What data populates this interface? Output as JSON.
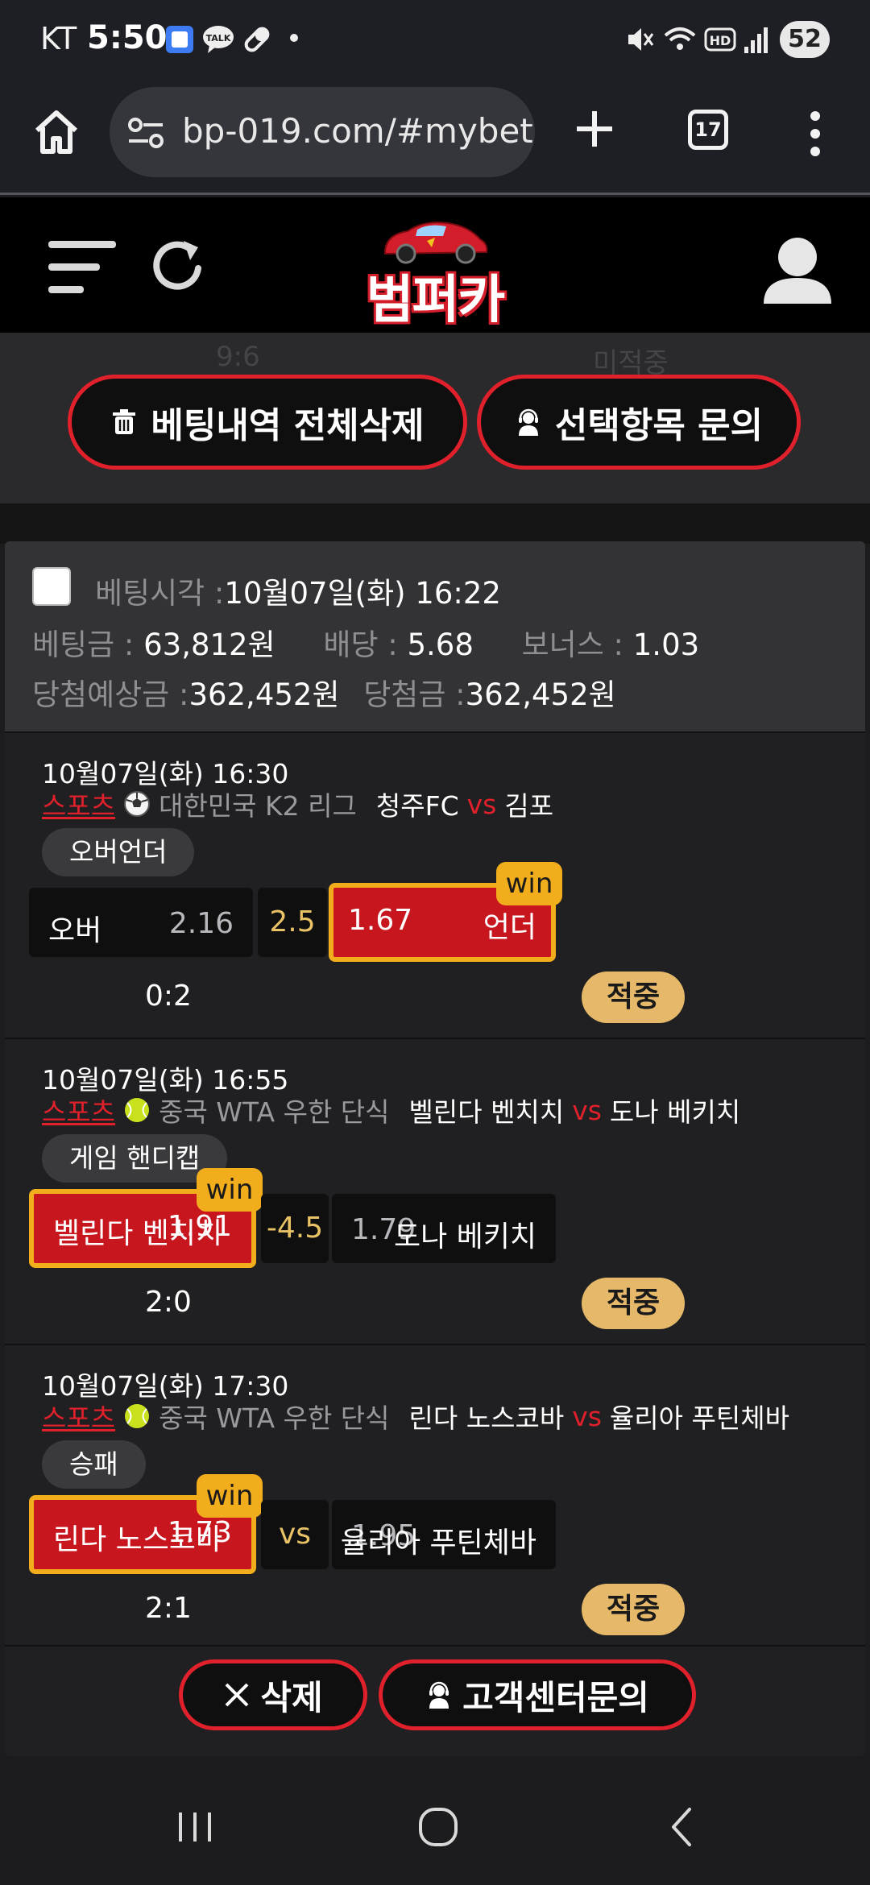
{
  "status_bar": {
    "carrier": "KT",
    "time": "5:50",
    "battery": "52"
  },
  "browser": {
    "url": "bp-019.com/#mybet",
    "tab_count": "17"
  },
  "site": {
    "logo_text": "범퍼카"
  },
  "actions": {
    "delete_all_label": "베팅내역 전체삭제",
    "inquiry_selected_label": "선택항목 문의",
    "ghost_score": "9:6",
    "ghost_status": "미적중"
  },
  "bet": {
    "time_label": "베팅시각 :",
    "time_value": "10월07일(화) 16:22",
    "amount_label": "베팅금 :",
    "amount_value": "63,812원",
    "odds_label": "배당 :",
    "odds_value": "5.68",
    "bonus_label": "보너스 :",
    "bonus_value": "1.03",
    "expected_label": "당첨예상금 :",
    "expected_value": "362,452원",
    "payout_label": "당첨금 :",
    "payout_value": "362,452원"
  },
  "matches": [
    {
      "datetime": "10월07일(화) 16:30",
      "sport": "스포츠",
      "league": "대한민국 K2 리그",
      "home": "청주FC",
      "vs": "vs",
      "away": "김포",
      "market": "오버언더",
      "left_name": "오버",
      "left_price": "2.16",
      "middle": "2.5",
      "right_name": "언더",
      "right_price": "1.67",
      "win_label": "win",
      "score": "0:2",
      "result": "적중"
    },
    {
      "datetime": "10월07일(화) 16:55",
      "sport": "스포츠",
      "league": "중국 WTA 우한 단식",
      "home": "벨린다 벤치치",
      "vs": "vs",
      "away": "도나 베키치",
      "market": "게임 핸디캡",
      "left_name": "벨린다 벤치치",
      "left_price": "1.91",
      "middle": "-4.5",
      "right_name": "도나 베키치",
      "right_price": "1.79",
      "win_label": "win",
      "score": "2:0",
      "result": "적중"
    },
    {
      "datetime": "10월07일(화) 17:30",
      "sport": "스포츠",
      "league": "중국 WTA 우한 단식",
      "home": "린다 노스코바",
      "vs": "vs",
      "away": "율리아 푸틴체바",
      "market": "승패",
      "left_name": "린다 노스코바",
      "left_price": "1.73",
      "middle": "vs",
      "right_name": "율리아 푸틴체바",
      "right_price": "1.95",
      "win_label": "win",
      "score": "2:1",
      "result": "적중"
    }
  ],
  "footer": {
    "delete_label": "삭제",
    "support_label": "고객센터문의"
  },
  "colors": {
    "accent_red": "#e0202b",
    "win_gold": "#f2ad1d",
    "hit_badge": "#e6b96a",
    "line_gold": "#e9c266"
  }
}
